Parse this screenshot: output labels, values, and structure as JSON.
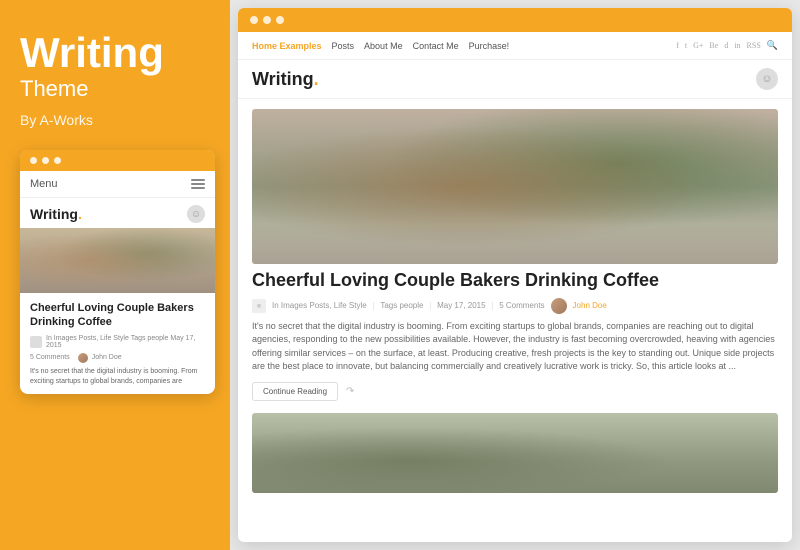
{
  "left": {
    "title": "Writing",
    "subtitle": "Theme",
    "by": "By A-Works",
    "mobile": {
      "menu_label": "Menu",
      "logo": "Writing",
      "logo_dot": ".",
      "article_title": "Cheerful Loving Couple Bakers Drinking Coffee",
      "meta_text": "In Images Posts, Life Style  Tags people   May 17, 2015",
      "meta_comments": "5 Comments",
      "meta_author": "John Doe",
      "excerpt": "It's no secret that the digital industry is booming. From exciting startups to global brands, companies are"
    }
  },
  "browser": {
    "nav": {
      "links": [
        {
          "label": "Home Examples",
          "active": true
        },
        {
          "label": "Posts",
          "active": false
        },
        {
          "label": "About Me",
          "active": false
        },
        {
          "label": "Contact Me",
          "active": false
        },
        {
          "label": "Purchase!",
          "active": false
        }
      ],
      "social_icons": [
        "f",
        "t",
        "G+",
        "Be",
        "d",
        "in",
        "RSS"
      ]
    },
    "logo": "Writing",
    "logo_dot": ".",
    "article": {
      "title": "Cheerful Loving Couple Bakers Drinking Coffee",
      "meta_category": "In Images Posts, Life Style",
      "meta_tags": "Tags people",
      "meta_date": "May 17, 2015",
      "meta_comments": "5 Comments",
      "meta_author": "John Doe",
      "excerpt": "It's no secret that the digital industry is booming. From exciting startups to global brands, companies are reaching out to digital agencies, responding to the new possibilities available. However, the industry is fast becoming overcrowded, heaving with agencies offering similar services – on the surface, at least. Producing creative, fresh projects is the key to standing out. Unique side projects are the best place to innovate, but balancing commercially and creatively lucrative work is tricky. So, this article looks at ...",
      "continue_label": "Continue Reading"
    }
  },
  "colors": {
    "orange": "#F5A623",
    "dark": "#222222",
    "gray": "#888888"
  }
}
